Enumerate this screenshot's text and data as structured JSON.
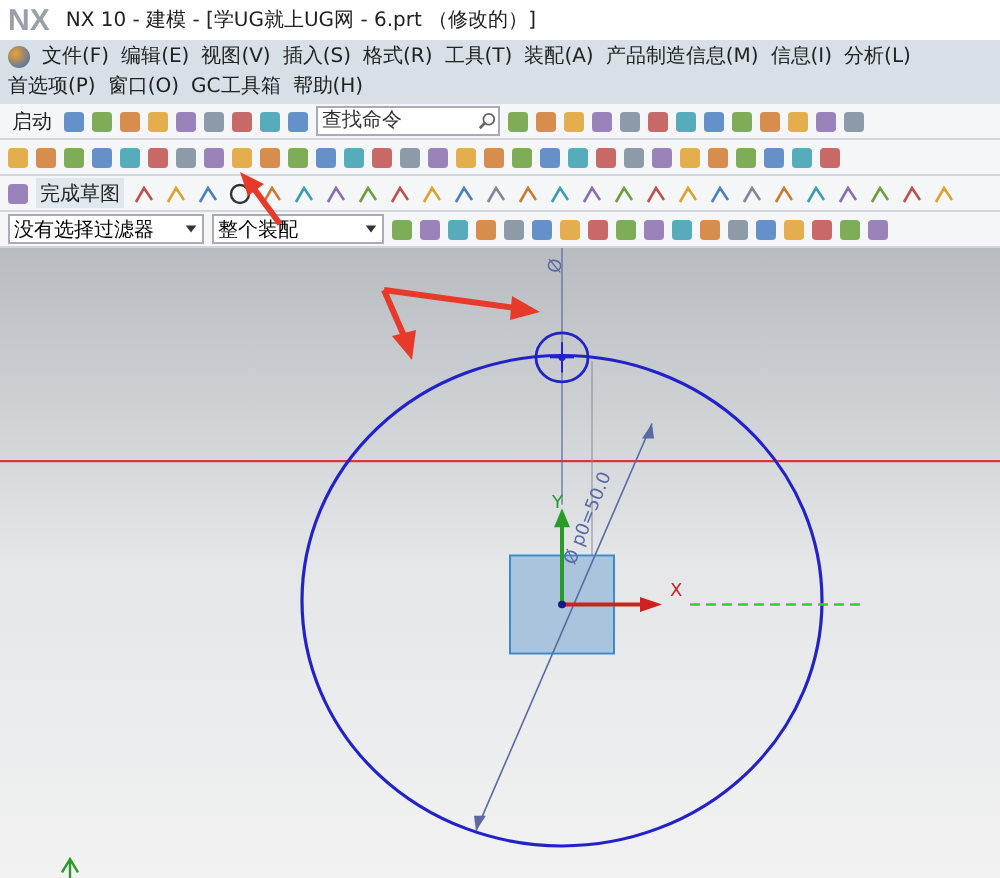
{
  "window": {
    "logo": "NX",
    "title": "NX 10 - 建模 - [学UG就上UG网 - 6.prt （修改的）]"
  },
  "menu": [
    "文件(F)",
    "编辑(E)",
    "视图(V)",
    "插入(S)",
    "格式(R)",
    "工具(T)",
    "装配(A)",
    "产品制造信息(M)",
    "信息(I)",
    "分析(L)",
    "首选项(P)",
    "窗口(O)",
    "GC工具箱",
    "帮助(H)"
  ],
  "toolbar": {
    "start_button": "启动",
    "search": {
      "placeholder": "查找命令"
    },
    "finish_sketch": "完成草图"
  },
  "filters": [
    {
      "value": "没有选择过滤器"
    },
    {
      "value": "整个装配"
    }
  ],
  "canvas": {
    "top_dimension": "Ø",
    "diameter_dimension": "Ø p0=50.0",
    "x_axis": "X",
    "y_axis": "Y"
  }
}
